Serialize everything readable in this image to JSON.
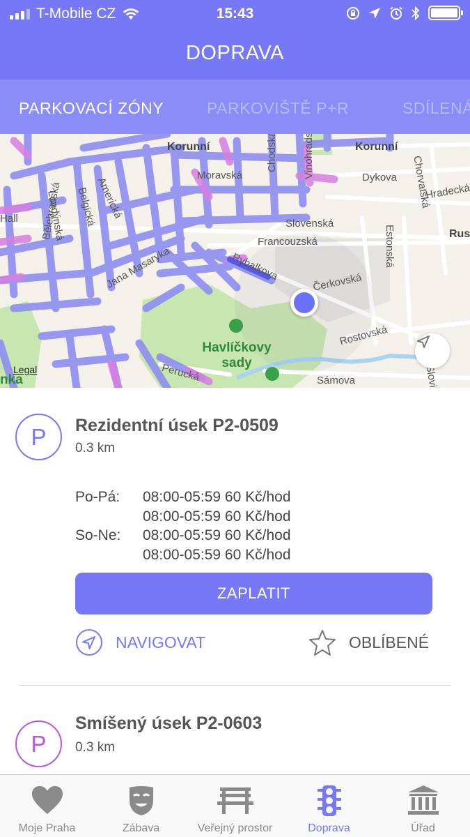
{
  "status_bar": {
    "carrier": "T-Mobile CZ",
    "time": "15:43"
  },
  "header": {
    "title": "DOPRAVA"
  },
  "tabs": [
    {
      "label": "PARKOVACÍ ZÓNY",
      "active": true
    },
    {
      "label": "PARKOVIŠTĚ P+R",
      "active": false
    },
    {
      "label": "SDÍLENÁ",
      "active": false
    }
  ],
  "map": {
    "legal_label": "Legal",
    "park_name": "Havlíčkovy sady",
    "streets": [
      "Korunní",
      "Korunní",
      "Moravská",
      "Dykova",
      "Chodská",
      "Vinohradská",
      "Chorvatská",
      "Hradecká",
      "Slovenská",
      "Ruská",
      "Hall",
      "Londýnská",
      "Belgická",
      "Americká",
      "Francouzská",
      "Estonská",
      "Bělehradská",
      "Jana Masaryka",
      "Rybalkova",
      "Čerkovská",
      "Rostovská",
      "Perucká",
      "Sámova",
      "nka",
      "Slovinská"
    ],
    "colors": {
      "resident": "#8e8ef0",
      "mixed": "#d77ee0",
      "park": "#c8e6b0",
      "water": "#a8d4f0"
    }
  },
  "zones": [
    {
      "icon_letter": "P",
      "title": "Rezidentní úsek P2-0509",
      "distance": "0.3 km",
      "color": "#7678f5",
      "schedule": [
        {
          "day": "Po-Pá:",
          "value": "08:00-05:59 60 Kč/hod"
        },
        {
          "day": "",
          "value": "08:00-05:59 60 Kč/hod"
        },
        {
          "day": "So-Ne:",
          "value": "08:00-05:59 60 Kč/hod"
        },
        {
          "day": "",
          "value": "08:00-05:59 60 Kč/hod"
        }
      ],
      "pay_label": "ZAPLATIT",
      "navigate_label": "NAVIGOVAT",
      "favorite_label": "OBLÍBENÉ"
    },
    {
      "icon_letter": "P",
      "title": "Smíšený úsek P2-0603",
      "distance": "0.3 km",
      "color": "#b657e8"
    }
  ],
  "tabbar": {
    "items": [
      {
        "label": "Moje Praha",
        "icon": "heart-icon"
      },
      {
        "label": "Zábava",
        "icon": "mask-icon"
      },
      {
        "label": "Veřejný prostor",
        "icon": "bench-icon"
      },
      {
        "label": "Doprava",
        "icon": "traffic-light-icon",
        "active": true
      },
      {
        "label": "Úřad",
        "icon": "building-icon"
      }
    ]
  }
}
